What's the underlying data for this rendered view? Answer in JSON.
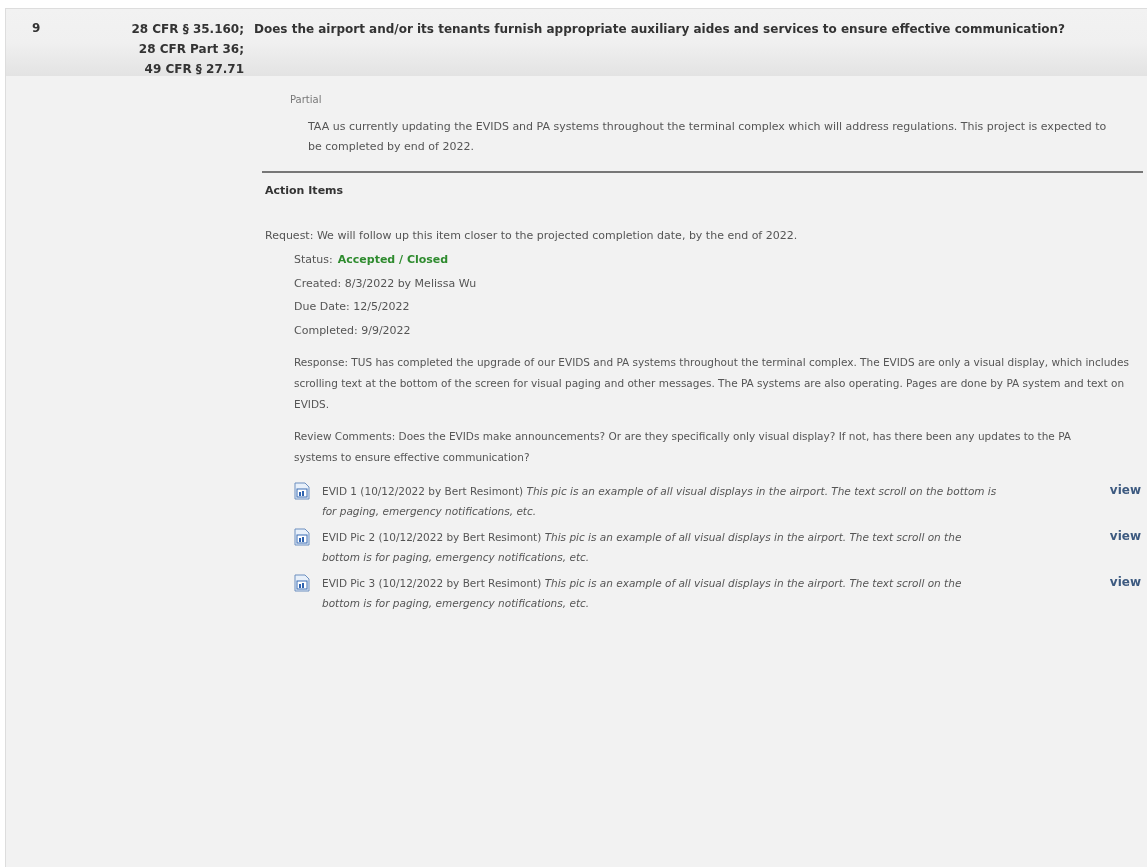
{
  "question": {
    "number": "9",
    "citations": [
      "28 CFR § 35.160;",
      "28 CFR Part 36;",
      "49 CFR § 27.71"
    ],
    "text": "Does the airport and/or its tenants furnish appropriate auxiliary aides and services to ensure effective communication?"
  },
  "answer": {
    "rating": "Partial",
    "comment": "TAA us currently updating the EVIDS and PA systems throughout the terminal complex which will address regulations. This project is expected to be completed by end of 2022."
  },
  "action_items": {
    "heading": "Action Items",
    "request": "Request: We will follow up this item closer to the projected completion date, by the end of 2022.",
    "status_label": "Status:",
    "status_value": "Accepted / Closed",
    "details": [
      "Created: 8/3/2022 by Melissa Wu",
      "Due Date: 12/5/2022",
      "Completed: 9/9/2022"
    ],
    "response": "Response: TUS has completed the upgrade of our EVIDS and PA systems throughout the terminal complex. The EVIDS are only a visual display, which includes scrolling text at the bottom of the screen for visual paging and other messages. The PA systems are also operating. Pages are done by PA system and text on EVIDS.",
    "review": "Review Comments: Does the EVIDs make announcements? Or are they specifically only visual display? If not, has there been any updates to the PA systems to ensure effective communication?",
    "attachments": [
      {
        "text": "EVID 1 (10/12/2022 by Bert Resimont) *This pic is an example of all visual displays in the airport. The text scroll on the bottom is for paging, emergency notifications, etc.*",
        "link": "view"
      },
      {
        "text": "EVID Pic 2 (10/12/2022 by Bert Resimont) *This pic is an example of all visual displays in the airport. The text scroll on the bottom is for paging, emergency notifications, etc.*",
        "link": "view"
      },
      {
        "text": "EVID Pic 3 (10/12/2022 by Bert Resimont) *This pic is an example of all visual displays in the airport. The text scroll on the bottom is for paging, emergency notifications, etc.*",
        "link": "view"
      }
    ]
  }
}
